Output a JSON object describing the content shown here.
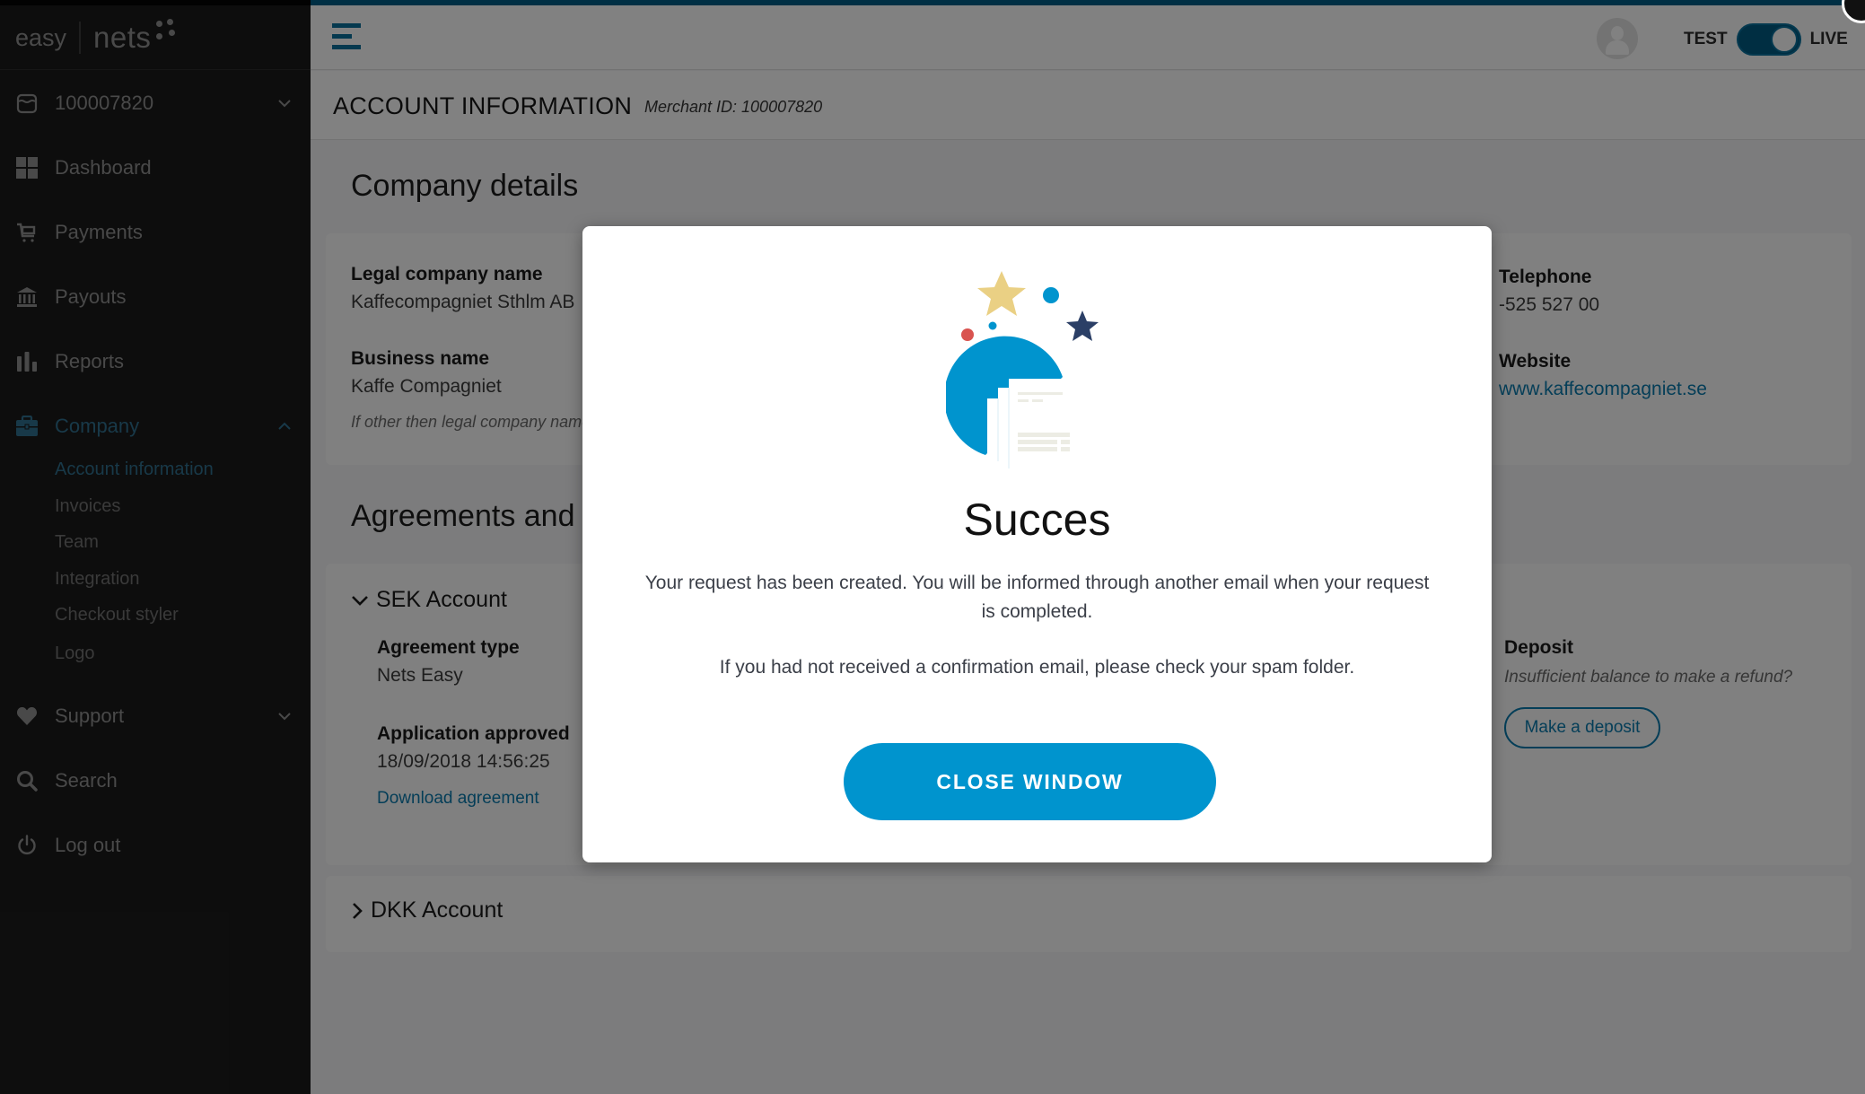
{
  "brand": {
    "left": "easy",
    "right": "nets"
  },
  "sidebar": {
    "merchant_selector": {
      "label": "100007820",
      "icon": "store-icon"
    },
    "items": [
      {
        "label": "Dashboard",
        "icon": "grid-icon"
      },
      {
        "label": "Payments",
        "icon": "cart-icon"
      },
      {
        "label": "Payouts",
        "icon": "bank-icon"
      },
      {
        "label": "Reports",
        "icon": "bar-chart-icon"
      },
      {
        "label": "Company",
        "icon": "briefcase-icon",
        "expanded": true,
        "active": true
      },
      {
        "label": "Support",
        "icon": "heart-icon"
      },
      {
        "label": "Search",
        "icon": "search-icon"
      },
      {
        "label": "Log out",
        "icon": "power-icon"
      }
    ],
    "company_subitems": [
      {
        "label": "Account information",
        "active": true
      },
      {
        "label": "Invoices"
      },
      {
        "label": "Team"
      },
      {
        "label": "Integration"
      },
      {
        "label": "Checkout styler"
      },
      {
        "label": "Logo"
      }
    ]
  },
  "header": {
    "env_left": "TEST",
    "env_right": "LIVE",
    "env_live_on": true
  },
  "page": {
    "title": "ACCOUNT INFORMATION",
    "merchant_id_text": "Merchant ID: 100007820"
  },
  "company_details": {
    "heading": "Company details",
    "legal_name_label": "Legal company name",
    "legal_name_value": "Kaffecompagniet Sthlm AB",
    "business_name_label": "Business name",
    "business_name_value": "Kaffe Compagniet",
    "business_name_hint": "If other then legal company name",
    "telephone_label": "Telephone",
    "telephone_value": "-525 527 00",
    "website_label": "Website",
    "website_value": "www.kaffecompagniet.se"
  },
  "agreements": {
    "heading": "Agreements and Bank accounts",
    "sek": {
      "title": "SEK Account",
      "agreement_type_label": "Agreement type",
      "agreement_type_value": "Nets Easy",
      "approved_label": "Application approved",
      "approved_value": "18/09/2018 14:56:25",
      "download_link": "Download agreement",
      "deposit_label": "Deposit",
      "deposit_hint": "Insufficient balance to make a refund?",
      "deposit_button": "Make a deposit"
    },
    "dkk": {
      "title": "DKK Account"
    }
  },
  "modal": {
    "title": "Succes",
    "message": "Your request has been created. You will be informed through another email when your request is completed.",
    "message2": "If you had not received a confirmation email, please check your spam folder.",
    "button": "CLOSE WINDOW",
    "colors": {
      "primary": "#0094ce",
      "star_gold": "#ead084",
      "star_navy": "#2b3f66",
      "dot_red": "#d9534f"
    }
  }
}
